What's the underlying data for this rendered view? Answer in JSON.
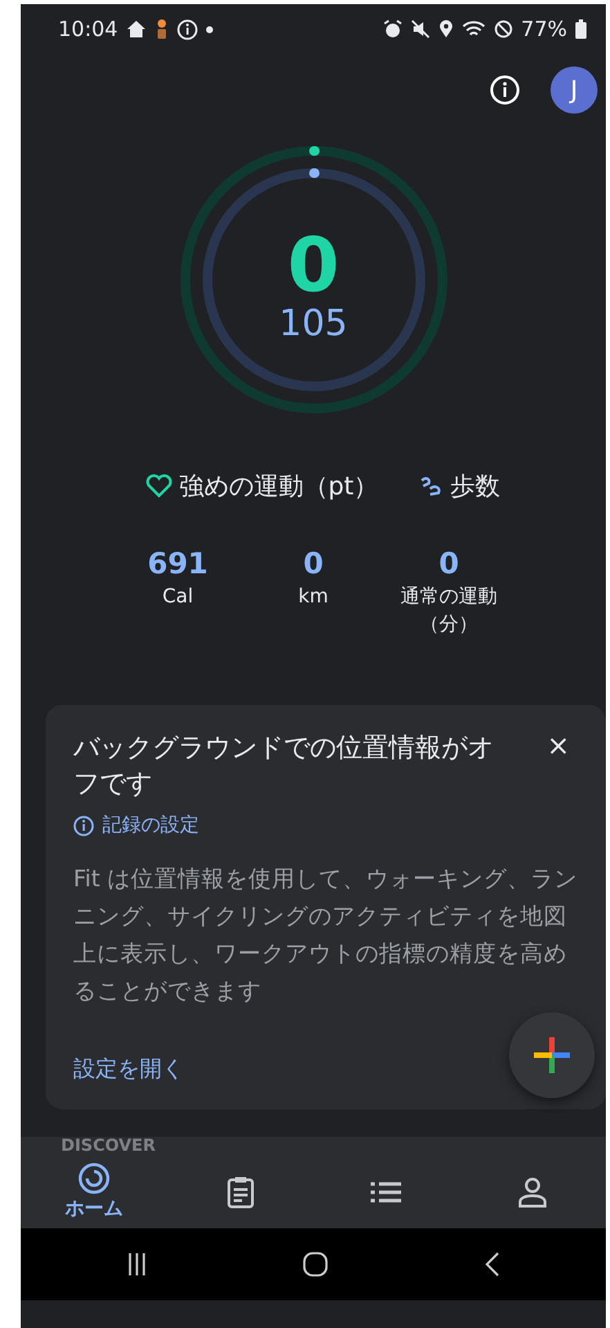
{
  "status_bar": {
    "time": "10:04",
    "battery": "77%"
  },
  "header": {
    "avatar_initial": "J"
  },
  "rings": [
    {
      "kind": "heart",
      "level": 0
    },
    {
      "kind": "steps",
      "level": 0
    }
  ],
  "goals": {
    "heart_value": "0",
    "steps_value": "105"
  },
  "legend": [
    {
      "kind": "heart",
      "label": "強めの運動（pt）"
    },
    {
      "kind": "steps",
      "label": "歩数"
    }
  ],
  "stats": [
    {
      "value": "691",
      "label": "Cal"
    },
    {
      "value": "0",
      "label": "km"
    },
    {
      "value": "0",
      "label": "通常の運動（分）"
    }
  ],
  "card": {
    "title": "バックグラウンドでの位置情報がオフです",
    "close": "×",
    "link": "記録の設定",
    "body": "Fit は位置情報を使用して、ウォーキング、ランニング、サイクリングのアクティビティを地図上に表示し、ワークアウトの指標の精度を高めることができます",
    "action": "設定を開く"
  },
  "discover": "DISCOVER",
  "nav": [
    {
      "kind": "home",
      "label": "ホーム",
      "selected": true
    },
    {
      "kind": "journal",
      "selected": false
    },
    {
      "kind": "browse",
      "selected": false
    },
    {
      "kind": "profile",
      "selected": false
    }
  ]
}
